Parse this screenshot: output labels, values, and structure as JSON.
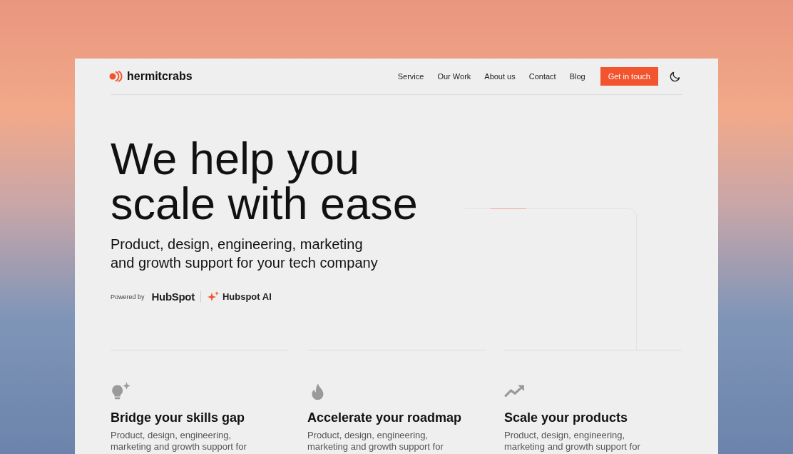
{
  "brand": {
    "name": "hermitcrabs"
  },
  "nav": {
    "items": [
      {
        "label": "Service"
      },
      {
        "label": "Our Work"
      },
      {
        "label": "About us"
      },
      {
        "label": "Contact"
      },
      {
        "label": "Blog"
      }
    ],
    "cta": "Get in touch"
  },
  "hero": {
    "title_lines": [
      "We help you",
      "scale with ease"
    ],
    "subtitle_lines": [
      "Product, design, engineering, marketing",
      "and growth support for your tech company"
    ],
    "powered_by": "Powered by",
    "partner_logo": "HubSpot",
    "partner_ai": "Hubspot AI"
  },
  "features": [
    {
      "kind": "bulb",
      "title": "Bridge your skills gap",
      "text_lines": [
        "Product, design, engineering,",
        "marketing and growth support for"
      ]
    },
    {
      "kind": "flame",
      "title": "Accelerate your roadmap",
      "text_lines": [
        "Product, design, engineering,",
        "marketing and growth support for"
      ]
    },
    {
      "kind": "trend",
      "title": "Scale your products",
      "text_lines": [
        "Product, design, engineering,",
        "marketing and growth support for"
      ]
    }
  ]
}
